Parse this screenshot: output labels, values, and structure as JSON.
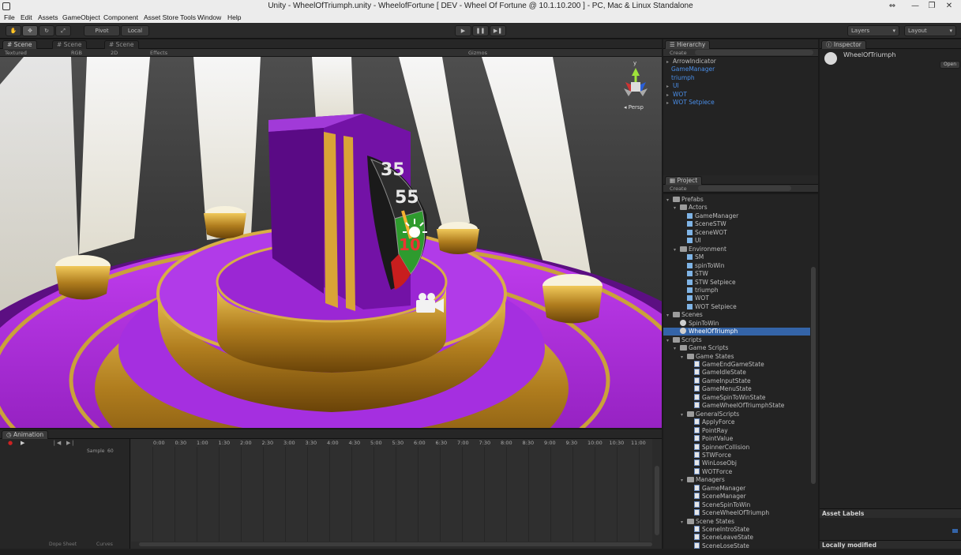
{
  "window": {
    "title": "Unity - WheelOfTriumph.unity - WheelofFortune [ DEV - Wheel Of Fortune @ 10.1.10.200 ] - PC, Mac & Linux Standalone",
    "controls": [
      "⇔",
      "—",
      "❐",
      "✕"
    ]
  },
  "menu": [
    "File",
    "Edit",
    "Assets",
    "GameObject",
    "Component",
    "Asset Store Tools",
    "Window",
    "Help"
  ],
  "toolbar": {
    "pivot": "Pivot",
    "local": "Local",
    "layers": "Layers",
    "layout": "Layout"
  },
  "scene": {
    "tabs": [
      "Scene",
      "Scene",
      "Scene"
    ],
    "shading": "Textured",
    "render": "RGB",
    "mode2d": "2D",
    "effects": "Effects",
    "gizmos": "Gizmos",
    "persp": "Persp",
    "axis_y": "y",
    "wheel_numbers": [
      "35",
      "55",
      "10"
    ]
  },
  "hierarchy": {
    "tab": "Hierarchy",
    "create": "Create",
    "items": [
      {
        "label": "ArrowIndicator",
        "color": "default"
      },
      {
        "label": "GameManager",
        "color": "blue"
      },
      {
        "label": "triumph",
        "color": "blue"
      },
      {
        "label": "UI",
        "color": "blue"
      },
      {
        "label": "WOT",
        "color": "blue"
      },
      {
        "label": "WOT Setpiece",
        "color": "blue"
      }
    ]
  },
  "project": {
    "tab": "Project",
    "create": "Create",
    "items": [
      {
        "label": "Prefabs",
        "indent": 0,
        "icon": "folder"
      },
      {
        "label": "Actors",
        "indent": 1,
        "icon": "folder"
      },
      {
        "label": "GameManager",
        "indent": 2,
        "icon": "cube"
      },
      {
        "label": "SceneSTW",
        "indent": 2,
        "icon": "cube"
      },
      {
        "label": "SceneWOT",
        "indent": 2,
        "icon": "cube"
      },
      {
        "label": "UI",
        "indent": 2,
        "icon": "cube"
      },
      {
        "label": "Environment",
        "indent": 1,
        "icon": "folder"
      },
      {
        "label": "SM",
        "indent": 2,
        "icon": "cube"
      },
      {
        "label": "spinToWin",
        "indent": 2,
        "icon": "cube"
      },
      {
        "label": "STW",
        "indent": 2,
        "icon": "cube"
      },
      {
        "label": "STW Setpiece",
        "indent": 2,
        "icon": "cube"
      },
      {
        "label": "triumph",
        "indent": 2,
        "icon": "cube"
      },
      {
        "label": "WOT",
        "indent": 2,
        "icon": "cube"
      },
      {
        "label": "WOT Setpiece",
        "indent": 2,
        "icon": "cube"
      },
      {
        "label": "Scenes",
        "indent": 0,
        "icon": "folder"
      },
      {
        "label": "SpinToWin",
        "indent": 1,
        "icon": "unity"
      },
      {
        "label": "WheelOfTriumph",
        "indent": 1,
        "icon": "unity",
        "selected": true
      },
      {
        "label": "Scripts",
        "indent": 0,
        "icon": "folder"
      },
      {
        "label": "Game Scripts",
        "indent": 1,
        "icon": "folder"
      },
      {
        "label": "Game States",
        "indent": 2,
        "icon": "folder"
      },
      {
        "label": "GameEndGameState",
        "indent": 3,
        "icon": "script"
      },
      {
        "label": "GameIdleState",
        "indent": 3,
        "icon": "script"
      },
      {
        "label": "GameInputState",
        "indent": 3,
        "icon": "script"
      },
      {
        "label": "GameMenuState",
        "indent": 3,
        "icon": "script"
      },
      {
        "label": "GameSpinToWinState",
        "indent": 3,
        "icon": "script"
      },
      {
        "label": "GameWheelOfTriumphState",
        "indent": 3,
        "icon": "script"
      },
      {
        "label": "GeneralScripts",
        "indent": 2,
        "icon": "folder"
      },
      {
        "label": "ApplyForce",
        "indent": 3,
        "icon": "script"
      },
      {
        "label": "PointRay",
        "indent": 3,
        "icon": "script"
      },
      {
        "label": "PointValue",
        "indent": 3,
        "icon": "script"
      },
      {
        "label": "SpinnerCollision",
        "indent": 3,
        "icon": "script"
      },
      {
        "label": "STWForce",
        "indent": 3,
        "icon": "script"
      },
      {
        "label": "WinLoseObj",
        "indent": 3,
        "icon": "script"
      },
      {
        "label": "WOTForce",
        "indent": 3,
        "icon": "script"
      },
      {
        "label": "Managers",
        "indent": 2,
        "icon": "folder"
      },
      {
        "label": "GameManager",
        "indent": 3,
        "icon": "script"
      },
      {
        "label": "SceneManager",
        "indent": 3,
        "icon": "script"
      },
      {
        "label": "SceneSpinToWin",
        "indent": 3,
        "icon": "script"
      },
      {
        "label": "SceneWheelOfTriumph",
        "indent": 3,
        "icon": "script"
      },
      {
        "label": "Scene States",
        "indent": 2,
        "icon": "folder"
      },
      {
        "label": "SceneIntroState",
        "indent": 3,
        "icon": "script"
      },
      {
        "label": "SceneLeaveState",
        "indent": 3,
        "icon": "script"
      },
      {
        "label": "SceneLoseState",
        "indent": 3,
        "icon": "script"
      }
    ]
  },
  "inspector": {
    "tab": "Inspector",
    "object_name": "WheelOfTriumph",
    "open": "Open",
    "asset_labels": "Asset Labels",
    "locally_modified": "Locally modified"
  },
  "animation": {
    "tab": "Animation",
    "sample_label": "Sample",
    "sample_value": "60",
    "ticks": [
      "0:00",
      "0:30",
      "1:00",
      "1:30",
      "2:00",
      "2:30",
      "3:00",
      "3:30",
      "4:00",
      "4:30",
      "5:00",
      "5:30",
      "6:00",
      "6:30",
      "7:00",
      "7:30",
      "8:00",
      "8:30",
      "9:00",
      "9:30",
      "10:00",
      "10:30",
      "11:00"
    ],
    "bottom_tabs": [
      "Dope Sheet",
      "Curves"
    ]
  }
}
